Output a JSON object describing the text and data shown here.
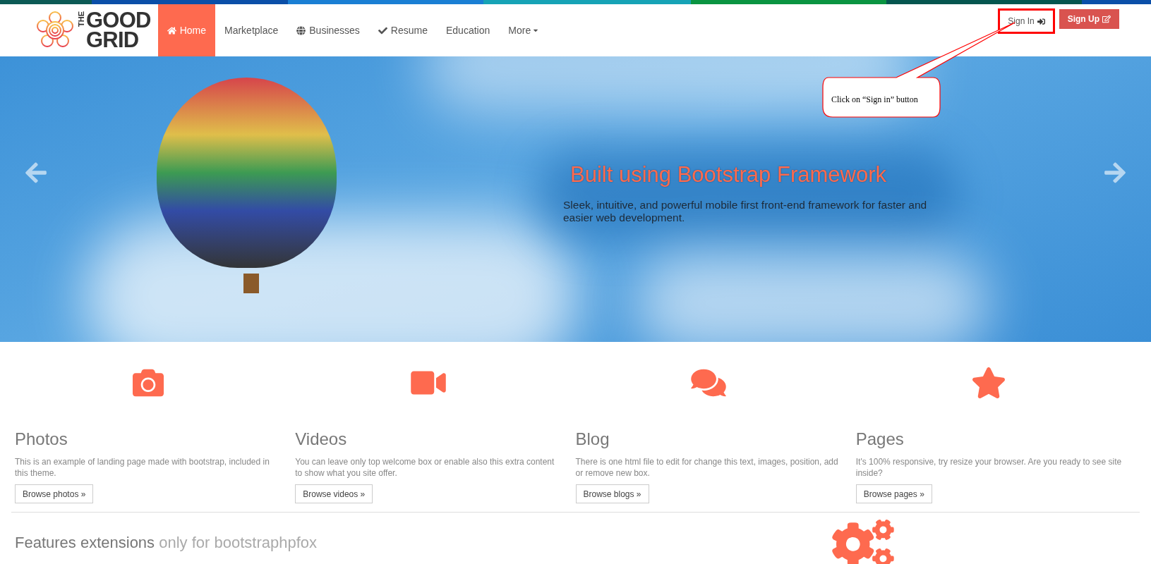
{
  "logo": {
    "small": "THE",
    "top": "GOOD",
    "bottom": "GRID"
  },
  "nav": [
    {
      "label": "Home",
      "selected": true
    },
    {
      "label": "Marketplace",
      "selected": false
    },
    {
      "label": "Businesses",
      "selected": false
    },
    {
      "label": "Resume",
      "selected": false
    },
    {
      "label": "Education",
      "selected": false
    },
    {
      "label": "More",
      "selected": false
    }
  ],
  "auth": {
    "sign_in": "Sign In",
    "sign_up": "Sign Up"
  },
  "annotation": {
    "text": "Click on “Sign in” button"
  },
  "hero": {
    "title": "Built using Bootstrap Framework",
    "subtitle": "Sleek, intuitive, and powerful mobile first front-end framework for faster and easier web development."
  },
  "features": [
    {
      "title": "Photos",
      "text": "This is an example of landing page made with bootstrap, included in this theme.",
      "button": "Browse photos »"
    },
    {
      "title": "Videos",
      "text": "You can leave only top welcome box or enable also this extra content to show what you site offer.",
      "button": "Browse videos »"
    },
    {
      "title": "Blog",
      "text": "There is one html file to edit for change this text, images, position, add or remove new box.",
      "button": "Browse blogs »"
    },
    {
      "title": "Pages",
      "text": "It's 100% responsive, try resize your browser. Are you ready to see site inside?",
      "button": "Browse pages »"
    }
  ],
  "section": {
    "title": "Features extensions",
    "subtitle": "only for bootstraphpfox"
  }
}
